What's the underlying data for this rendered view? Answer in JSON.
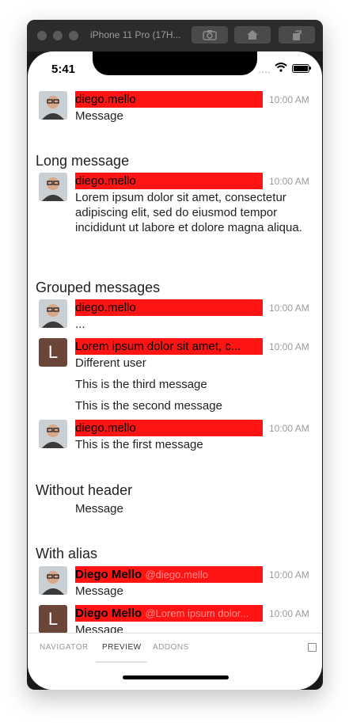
{
  "simulator": {
    "title": "iPhone 11 Pro (17H..."
  },
  "status_bar": {
    "time": "5:41"
  },
  "feed": {
    "m1": {
      "author": "diego.mello",
      "time": "10:00 AM",
      "text": "Message"
    },
    "long_title": "Long message",
    "m2": {
      "author": "diego.mello",
      "time": "10:00 AM",
      "text": "Lorem ipsum dolor sit amet, consectetur adipiscing elit, sed do eiusmod tempor incididunt ut labore et dolore magna aliqua."
    },
    "grouped_title": "Grouped messages",
    "m3": {
      "author": "diego.mello",
      "time": "10:00 AM",
      "text": "..."
    },
    "m4": {
      "author": "Lorem ipsum dolor sit amet, c...",
      "avatar_letter": "L",
      "time": "10:00 AM",
      "text": "Different user",
      "text2": "This is the third message",
      "text3": "This is the second message"
    },
    "m5": {
      "author": "diego.mello",
      "time": "10:00 AM",
      "text": "This is the first message"
    },
    "without_header_title": "Without header",
    "m6": {
      "text": "Message"
    },
    "alias_title": "With alias",
    "m7": {
      "author": "Diego Mello",
      "alias": "@diego.mello",
      "time": "10:00 AM",
      "text": "Message"
    },
    "m8": {
      "author": "Diego Mello",
      "alias": "@Lorem ipsum dolor...",
      "avatar_letter": "L",
      "time": "10:00 AM",
      "text": "Message"
    }
  },
  "tabs": {
    "navigator": "NAVIGATOR",
    "preview": "PREVIEW",
    "addons": "ADDONS"
  },
  "colors": {
    "header_highlight": "#ff1414",
    "avatar_letter_bg": "#6b4538"
  },
  "icons": {
    "screenshot": "camera-icon",
    "home": "home-icon",
    "rotate": "rotate-icon"
  }
}
